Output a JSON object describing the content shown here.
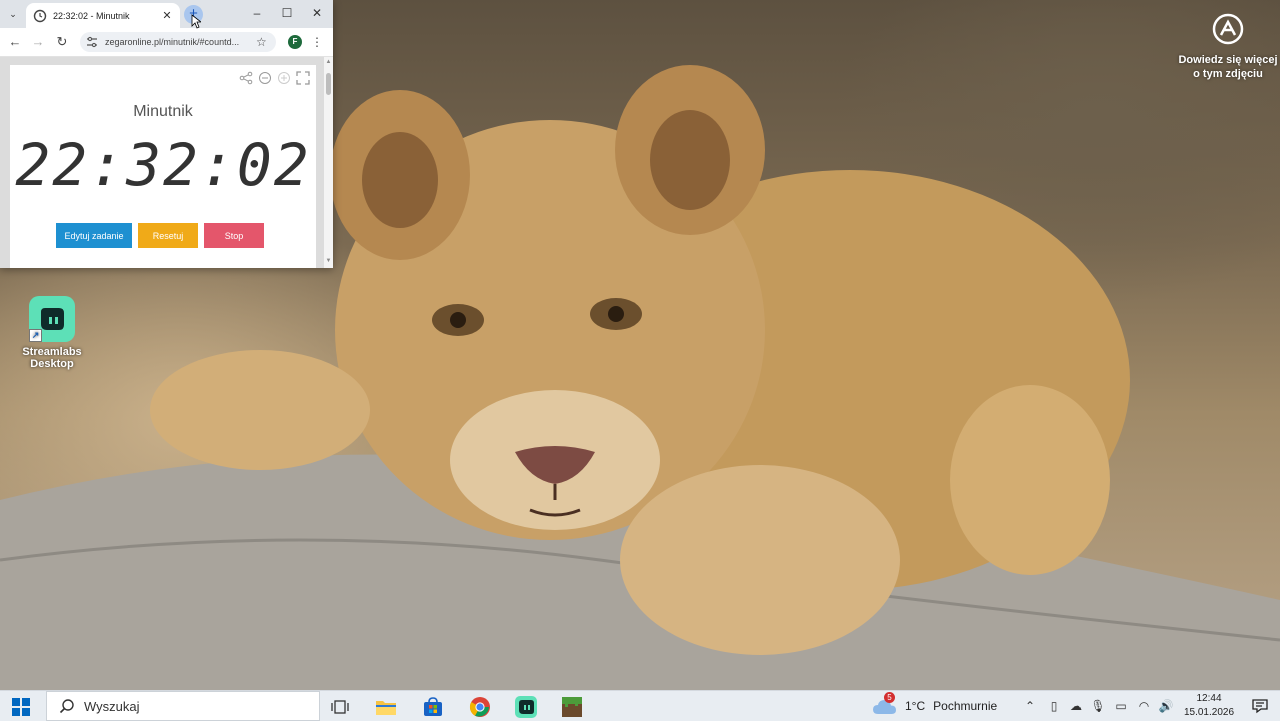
{
  "browser": {
    "tab": {
      "title": "22:32:02 - Minutnik"
    },
    "url": "zegaronline.pl/minutnik/#countd...",
    "profile_initial": "F"
  },
  "page": {
    "title": "Minutnik",
    "timer_value": "22:32:02",
    "buttons": {
      "edit": "Edytuj zadanie",
      "reset": "Resetuj",
      "stop": "Stop"
    },
    "colors": {
      "edit": "#1e90d1",
      "reset": "#f0aa18",
      "stop": "#e4566b"
    }
  },
  "desktop": {
    "wallpaper_info": "Dowiedz się więcej o tym zdjęciu",
    "icons": [
      {
        "label": "Streamlabs Desktop",
        "icon": "streamlabs-icon"
      }
    ]
  },
  "taskbar": {
    "search_placeholder": "Wyszukaj",
    "apps": [
      "task-view-icon",
      "file-explorer-icon",
      "microsoft-store-icon",
      "chrome-icon",
      "streamlabs-icon",
      "minecraft-icon"
    ],
    "weather": {
      "badge": "5",
      "temp": "1°C",
      "desc": "Pochmurnie"
    },
    "clock": {
      "time": "12:44",
      "date": "15.01.2026"
    }
  }
}
